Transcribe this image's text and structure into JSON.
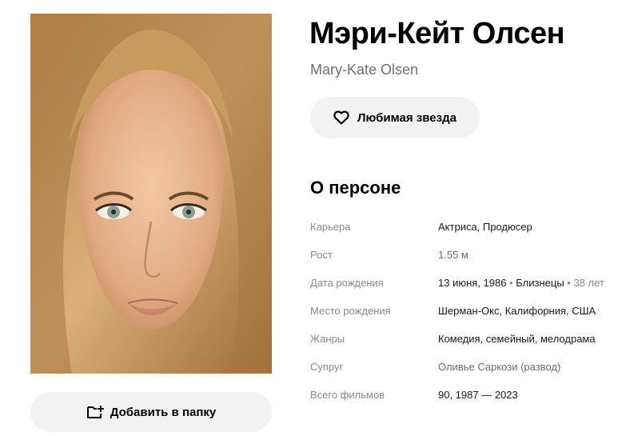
{
  "person": {
    "name": "Мэри-Кейт Олсен",
    "original_name": "Mary-Kate Olsen",
    "photo_icon": "portrait-photo"
  },
  "buttons": {
    "favorite_label": "Любимая звезда",
    "favorite_icon": "heart-icon",
    "folder_label": "Добавить в папку",
    "folder_icon": "folder-add-icon"
  },
  "about": {
    "title": "О персоне",
    "career_label": "Карьера",
    "career_value": "Актриса, Продюсер",
    "height_label": "Рост",
    "height_value": "1.55 м",
    "birth_label": "Дата рождения",
    "birth_date": "13 июня, 1986",
    "birth_sign": "Близнецы",
    "birth_age": "38 лет",
    "separator": "•",
    "place_label": "Место рождения",
    "place_value": "Шерман-Окс, Калифорния, США",
    "genres_label": "Жанры",
    "genres_value": "Комедия, семейный, мелодрама",
    "spouse_label": "Супруг",
    "spouse_value": "Оливье Саркози (развод)",
    "films_label": "Всего фильмов",
    "films_value": "90, 1987 — 2023"
  },
  "colors": {
    "button_bg": "#f2f2f2",
    "label_gray": "#8a8a8a",
    "subtitle_gray": "#707070"
  }
}
